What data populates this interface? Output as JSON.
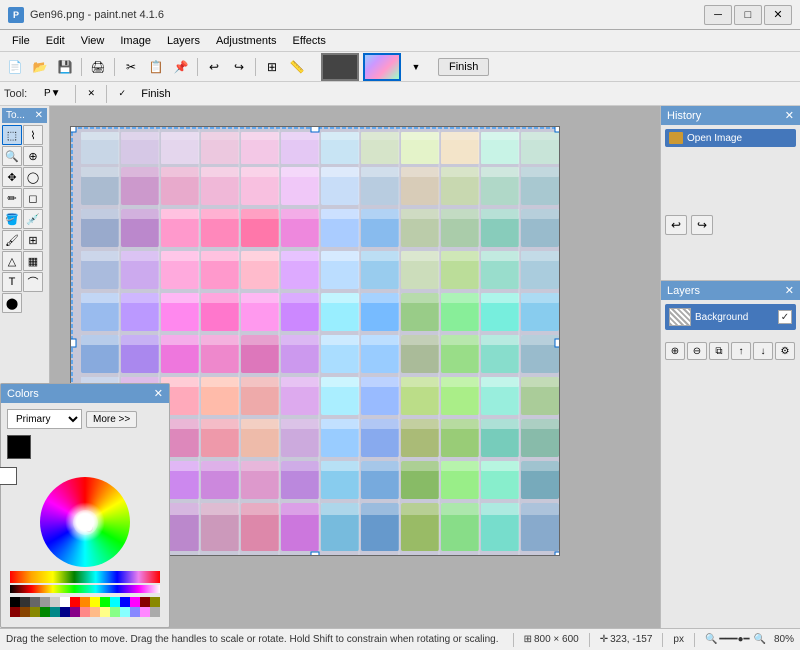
{
  "titlebar": {
    "title": "Gen96.png - paint.net 4.1.6",
    "icon": "P",
    "controls": {
      "minimize": "─",
      "maximize": "□",
      "close": "✕"
    }
  },
  "menubar": {
    "items": [
      "File",
      "Edit",
      "View",
      "Image",
      "Layers",
      "Adjustments",
      "Effects"
    ]
  },
  "toolbar": {
    "finish_label": "Finish"
  },
  "toolbar2": {
    "tool_label": "To...",
    "select_mode": "P▼"
  },
  "history": {
    "title": "History",
    "close": "✕",
    "items": [
      {
        "label": "Open Image",
        "icon": "img"
      }
    ],
    "undo": "↩",
    "redo": "↪"
  },
  "layers": {
    "title": "Layers",
    "close": "✕",
    "items": [
      {
        "label": "Background",
        "visible": true
      }
    ],
    "action_labels": [
      "⊕",
      "⊖",
      "⧉",
      "↑",
      "↓",
      "⚙"
    ]
  },
  "colors": {
    "title": "Colors",
    "close": "✕",
    "mode": "Primary",
    "more_button": "More >>",
    "primary": "#000000",
    "secondary": "#ffffff"
  },
  "statusbar": {
    "hint": "Drag the selection to move. Drag the handles to scale or rotate. Hold Shift to constrain when rotating or scaling.",
    "dimensions": "800 × 600",
    "coordinates": "323, -157",
    "unit": "px",
    "zoom": "80%"
  }
}
